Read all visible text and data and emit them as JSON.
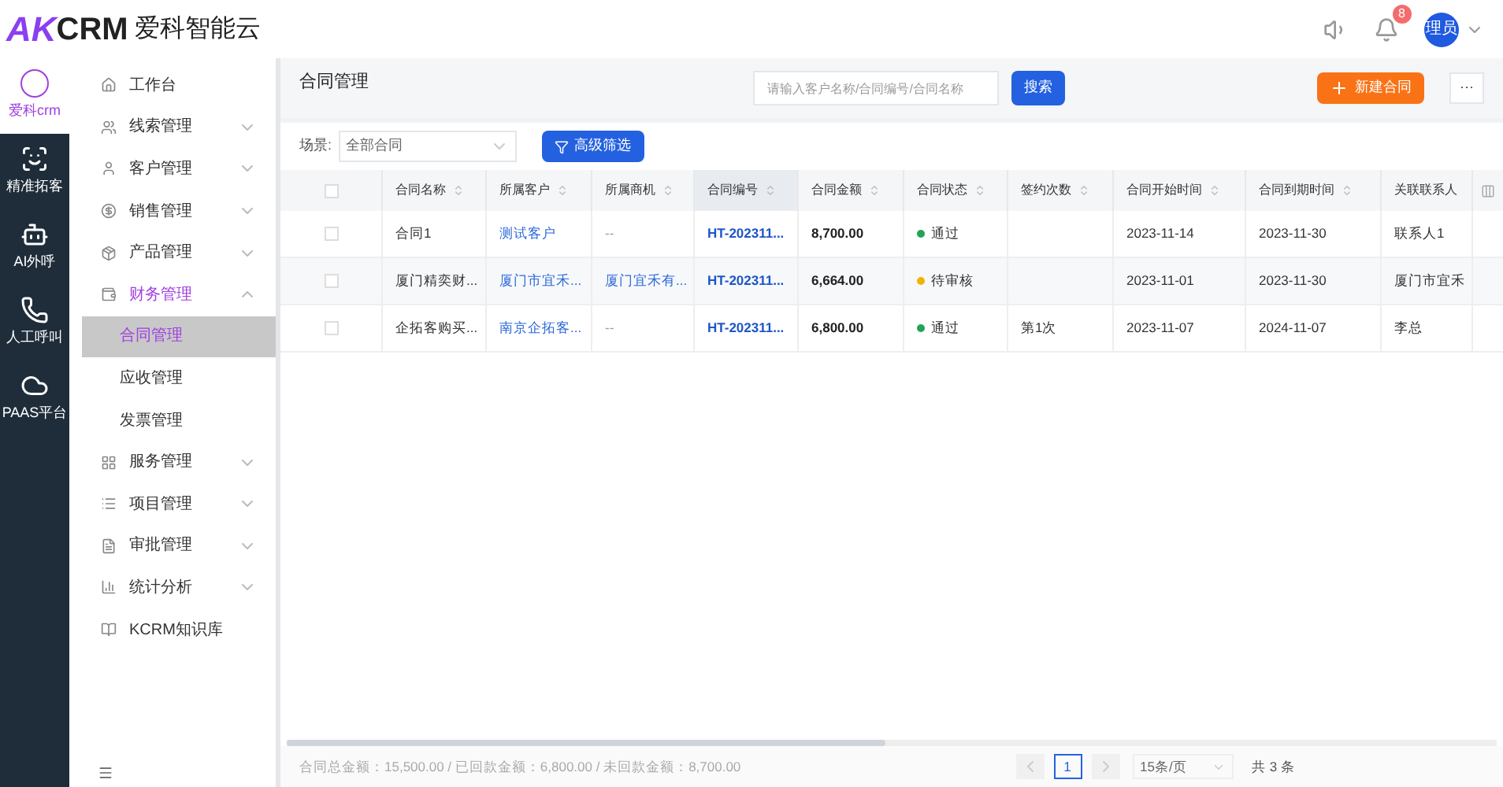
{
  "header": {
    "logo_mark": "AK",
    "logo_text": "CRM",
    "brand": "爱科智能云",
    "notification_count": "8",
    "avatar": "理员"
  },
  "rail": [
    {
      "label": "爱科crm",
      "kind": "crm",
      "selected": true
    },
    {
      "label": "精准拓客",
      "kind": "scan",
      "selected": false
    },
    {
      "label": "AI外呼",
      "kind": "ai",
      "selected": false
    },
    {
      "label": "人工呼叫",
      "kind": "phone",
      "selected": false
    },
    {
      "label": "PAAS平台",
      "kind": "cloud",
      "selected": false
    }
  ],
  "menu": [
    {
      "label": "工作台",
      "expanded": false,
      "has_children": false,
      "selected": false
    },
    {
      "label": "线索管理",
      "expanded": false,
      "has_children": true,
      "selected": false
    },
    {
      "label": "客户管理",
      "expanded": false,
      "has_children": true,
      "selected": false
    },
    {
      "label": "销售管理",
      "expanded": false,
      "has_children": true,
      "selected": false
    },
    {
      "label": "产品管理",
      "expanded": false,
      "has_children": true,
      "selected": false
    },
    {
      "label": "财务管理",
      "expanded": true,
      "has_children": true,
      "selected": true,
      "children": [
        {
          "label": "合同管理",
          "selected": true
        },
        {
          "label": "应收管理",
          "selected": false
        },
        {
          "label": "发票管理",
          "selected": false
        }
      ]
    },
    {
      "label": "服务管理",
      "expanded": false,
      "has_children": true,
      "selected": false
    },
    {
      "label": "项目管理",
      "expanded": false,
      "has_children": true,
      "selected": false
    },
    {
      "label": "审批管理",
      "expanded": false,
      "has_children": true,
      "selected": false
    },
    {
      "label": "统计分析",
      "expanded": false,
      "has_children": true,
      "selected": false
    },
    {
      "label": "KCRM知识库",
      "expanded": false,
      "has_children": false,
      "selected": false
    }
  ],
  "page": {
    "title": "合同管理",
    "search_placeholder": "请输入客户名称/合同编号/合同名称",
    "search_button": "搜索",
    "new_button": "新建合同",
    "more_button": "···"
  },
  "filter": {
    "label": "场景:",
    "value": "全部合同",
    "advanced_button": "高级筛选"
  },
  "table": {
    "all_checked": false,
    "columns": [
      {
        "label": "合同名称",
        "sortable": true,
        "selected": false
      },
      {
        "label": "所属客户",
        "sortable": true,
        "selected": false
      },
      {
        "label": "所属商机",
        "sortable": true,
        "selected": false
      },
      {
        "label": "合同编号",
        "sortable": true,
        "selected": true
      },
      {
        "label": "合同金额",
        "sortable": true,
        "selected": false
      },
      {
        "label": "合同状态",
        "sortable": true,
        "selected": false
      },
      {
        "label": "签约次数",
        "sortable": true,
        "selected": false
      },
      {
        "label": "合同开始时间",
        "sortable": true,
        "selected": false
      },
      {
        "label": "合同到期时间",
        "sortable": true,
        "selected": false
      },
      {
        "label": "关联联系人",
        "sortable": false,
        "selected": false
      }
    ],
    "rows": [
      {
        "checked": false,
        "name": "合同1",
        "customer": "测试客户",
        "opportunity": {
          "text": "--",
          "kind": "empty"
        },
        "number": "HT-202311...",
        "amount": "8,700.00",
        "status": "通过",
        "color": "#22a35a",
        "count": "",
        "start": "2023-11-14",
        "end": "2023-11-30",
        "contact": "联系人1"
      },
      {
        "checked": false,
        "name": "厦门精奕财...",
        "customer": "厦门市宜禾...",
        "opportunity": {
          "text": "厦门宜禾有...",
          "kind": "link"
        },
        "number": "HT-202311...",
        "amount": "6,664.00",
        "status": "待审核",
        "color": "#f0b400",
        "count": "",
        "start": "2023-11-01",
        "end": "2023-11-30",
        "contact": "厦门市宜禾"
      },
      {
        "checked": false,
        "name": "企拓客购买...",
        "customer": "南京企拓客...",
        "opportunity": {
          "text": "--",
          "kind": "empty"
        },
        "number": "HT-202311...",
        "amount": "6,800.00",
        "status": "通过",
        "color": "#22a35a",
        "count": "第1次",
        "start": "2023-11-07",
        "end": "2024-11-07",
        "contact": "李总"
      }
    ]
  },
  "footer": {
    "summary": "合同总金额：15,500.00 / 已回款金额：6,800.00 / 未回款金额：8,700.00",
    "page": "1",
    "page_size": "15条/页",
    "total": "共 3 条"
  }
}
